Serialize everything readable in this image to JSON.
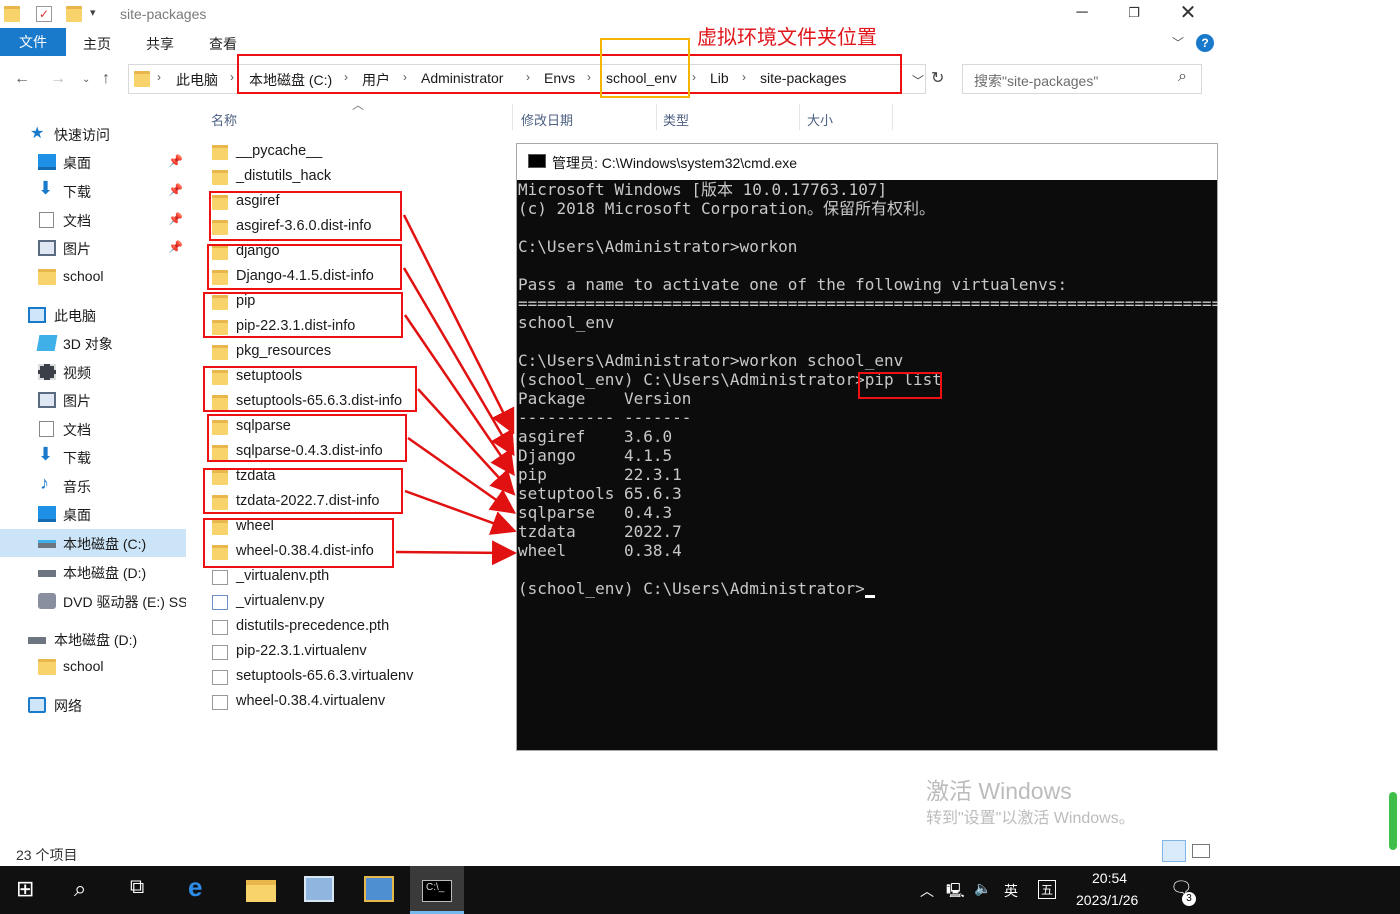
{
  "window": {
    "title": "site-packages"
  },
  "ribbon": {
    "tabs": [
      "文件",
      "主页",
      "共享",
      "查看"
    ]
  },
  "breadcrumb": [
    "此电脑",
    "本地磁盘 (C:)",
    "用户",
    "Administrator",
    "Envs",
    "school_env",
    "Lib",
    "site-packages"
  ],
  "search": {
    "placeholder": "搜索\"site-packages\""
  },
  "annotation": {
    "label": "虚拟环境文件夹位置"
  },
  "nav": {
    "quick_access": "快速访问",
    "quick_items": [
      "桌面",
      "下载",
      "文档",
      "图片",
      "school"
    ],
    "this_pc": "此电脑",
    "pc_items": [
      "3D 对象",
      "视频",
      "图片",
      "文档",
      "下载",
      "音乐",
      "桌面",
      "本地磁盘 (C:)",
      "本地磁盘 (D:)",
      "DVD 驱动器 (E:) SS"
    ],
    "drive_d": "本地磁盘 (D:)",
    "drive_d_items": [
      "school"
    ],
    "network": "网络"
  },
  "columns": {
    "name": "名称",
    "modified": "修改日期",
    "type": "类型",
    "size": "大小"
  },
  "files": [
    "__pycache__",
    "_distutils_hack",
    "asgiref",
    "asgiref-3.6.0.dist-info",
    "django",
    "Django-4.1.5.dist-info",
    "pip",
    "pip-22.3.1.dist-info",
    "pkg_resources",
    "setuptools",
    "setuptools-65.6.3.dist-info",
    "sqlparse",
    "sqlparse-0.4.3.dist-info",
    "tzdata",
    "tzdata-2022.7.dist-info",
    "wheel",
    "wheel-0.38.4.dist-info",
    "_virtualenv.pth",
    "_virtualenv.py",
    "distutils-precedence.pth",
    "pip-22.3.1.virtualenv",
    "setuptools-65.6.3.virtualenv",
    "wheel-0.38.4.virtualenv"
  ],
  "status": {
    "count": "23 个项目"
  },
  "cmd": {
    "title": "管理员: C:\\Windows\\system32\\cmd.exe",
    "lines": [
      "Microsoft Windows [版本 10.0.17763.107]",
      "(c) 2018 Microsoft Corporation。保留所有权利。",
      "",
      "C:\\Users\\Administrator>workon",
      "",
      "Pass a name to activate one of the following virtualenvs:",
      "==============================================================================",
      "school_env",
      "",
      "C:\\Users\\Administrator>workon school_env",
      "(school_env) C:\\Users\\Administrator>pip list",
      "Package    Version",
      "---------- -------",
      "asgiref    3.6.0",
      "Django     4.1.5",
      "pip        22.3.1",
      "setuptools 65.6.3",
      "sqlparse   0.4.3",
      "tzdata     2022.7",
      "wheel      0.38.4",
      "",
      "(school_env) C:\\Users\\Administrator>"
    ]
  },
  "watermark": {
    "line1": "激活 Windows",
    "line2": "转到\"设置\"以激活 Windows。"
  },
  "taskbar": {
    "time": "20:54",
    "date": "2023/1/26",
    "ime": "英",
    "ime2": "五",
    "notif_count": "3"
  },
  "colors": {
    "accent": "#1979ca",
    "annotation_red": "#e11111",
    "annotation_yellow": "#f4b400",
    "selection": "#cce4f7"
  }
}
